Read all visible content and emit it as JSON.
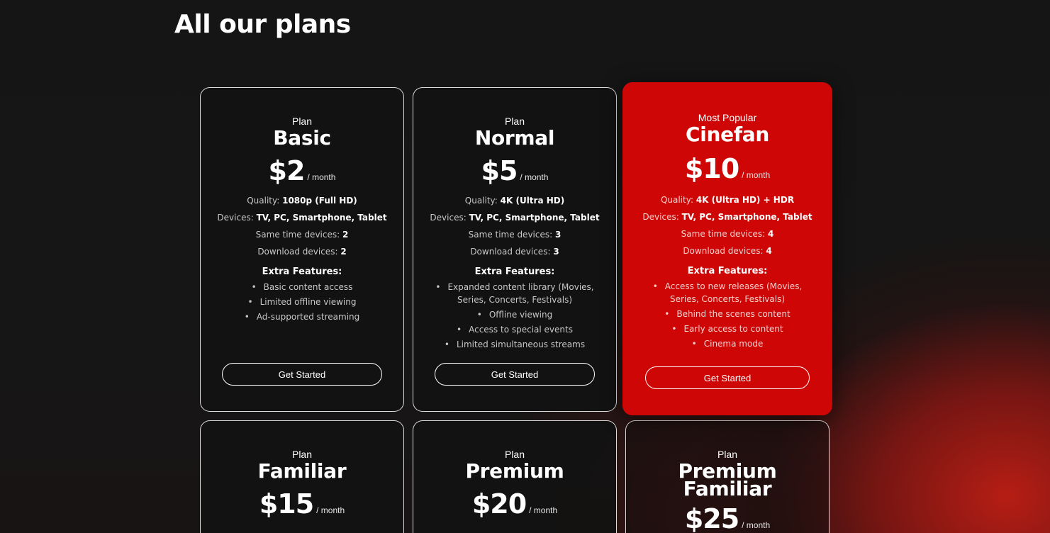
{
  "page": {
    "title": "All our plans"
  },
  "plans": [
    {
      "eyebrow": "Plan",
      "name": "Basic",
      "price": "$2",
      "period": "/ month",
      "quality_label": "Quality: ",
      "quality": "1080p (Full HD)",
      "devices_label": "Devices: ",
      "devices": "TV, PC, Smartphone, Tablet",
      "same_time_label": "Same time devices: ",
      "same_time": "2",
      "download_label": "Download devices: ",
      "download": "2",
      "extra_title": "Extra Features:",
      "features": [
        "Basic content access",
        "Limited offline viewing",
        "Ad-supported streaming"
      ],
      "cta": "Get Started"
    },
    {
      "eyebrow": "Plan",
      "name": "Normal",
      "price": "$5",
      "period": "/ month",
      "quality_label": "Quality: ",
      "quality": "4K (Ultra HD)",
      "devices_label": "Devices: ",
      "devices": "TV, PC, Smartphone, Tablet",
      "same_time_label": "Same time devices: ",
      "same_time": "3",
      "download_label": "Download devices: ",
      "download": "3",
      "extra_title": "Extra Features:",
      "features": [
        "Expanded content library (Movies, Series, Concerts, Festivals)",
        "Offline viewing",
        "Access to special events",
        "Limited simultaneous streams"
      ],
      "cta": "Get Started"
    },
    {
      "eyebrow": "Most Popular",
      "name": "Cinefan",
      "price": "$10",
      "period": "/ month",
      "quality_label": "Quality: ",
      "quality": "4K (Ultra HD) + HDR",
      "devices_label": "Devices: ",
      "devices": "TV, PC, Smartphone, Tablet",
      "same_time_label": "Same time devices: ",
      "same_time": "4",
      "download_label": "Download devices: ",
      "download": "4",
      "extra_title": "Extra Features:",
      "features": [
        "Access to new releases (Movies, Series, Concerts, Festivals)",
        "Behind the scenes content",
        "Early access to content",
        "Cinema mode"
      ],
      "cta": "Get Started"
    },
    {
      "eyebrow": "Plan",
      "name": "Familiar",
      "price": "$15",
      "period": "/ month"
    },
    {
      "eyebrow": "Plan",
      "name": "Premium",
      "price": "$20",
      "period": "/ month"
    },
    {
      "eyebrow": "Plan",
      "name": "Premium Familiar",
      "price": "$25",
      "period": "/ month"
    }
  ],
  "colors": {
    "featured": "#cf0606",
    "background": "#141414",
    "card_border": "#ffffff"
  }
}
